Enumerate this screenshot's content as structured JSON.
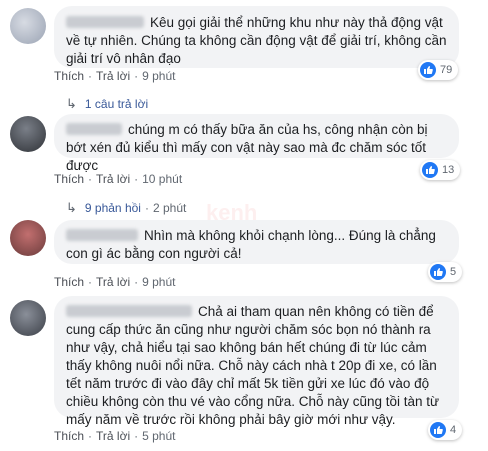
{
  "comments": [
    {
      "text": "Kêu gọi giải thể những khu như này thả động vật về tự nhiên. Chúng ta không cần động vật để giải trí, không cần giải trí vô nhân đạo",
      "like_label": "Thích",
      "reply_label": "Trả lời",
      "time": "9 phút",
      "reactions": "79",
      "replies_text": "1 câu trả lời",
      "replies_time": ""
    },
    {
      "text": "chúng m có thấy bữa ăn của hs, công nhận còn bị bớt xén đủ kiểu thì mấy con vật này sao mà đc chăm sóc tốt được",
      "like_label": "Thích",
      "reply_label": "Trả lời",
      "time": "10 phút",
      "reactions": "13",
      "replies_text": "9 phản hồi",
      "replies_time": "2 phút"
    },
    {
      "text": "Nhìn mà không khỏi chạnh lòng... Đúng là chẳng con gì ác bằng con người cả!",
      "like_label": "Thích",
      "reply_label": "Trả lời",
      "time": "9 phút",
      "reactions": "5"
    },
    {
      "text": "Chả ai tham quan nên không có tiền để cung cấp thức ăn cũng như người chăm sóc bọn nó thành ra như vậy, chả hiểu tại sao không bán hết chúng đi từ lúc cảm thấy không nuôi nổi nữa. Chỗ này cách nhà t 20p đi xe, có lần tết năm trước đi vào đây chỉ mất 5k tiền gửi xe lúc đó vào độ chiều không còn thu vé vào cổng nữa. Chỗ này cũng tồi tàn từ mấy năm về trước rồi không phải bây giờ mới như vậy.",
      "like_label": "Thích",
      "reply_label": "Trả lời",
      "time": "5 phút",
      "reactions": "4"
    }
  ],
  "colors": {
    "like": "#2078f4",
    "link": "#385898",
    "bubble": "#f2f3f5"
  },
  "icons": {
    "reaction": "thumbs-up-icon",
    "replies": "reply-arrow-icon"
  }
}
